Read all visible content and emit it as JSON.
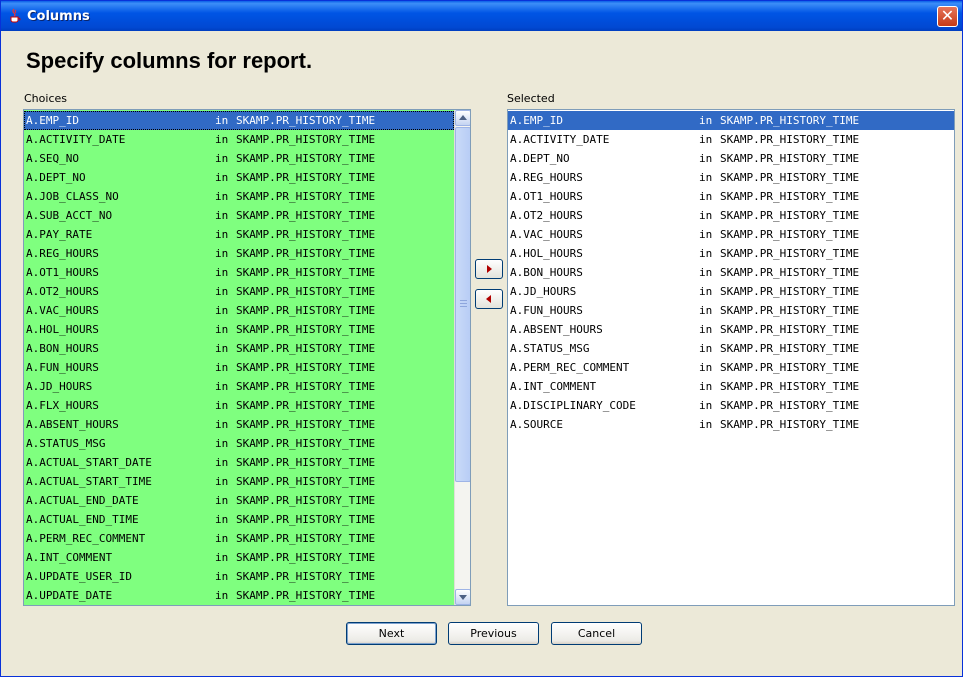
{
  "window": {
    "title": "Columns",
    "close_label": "✕"
  },
  "heading": "Specify columns for report.",
  "choices": {
    "label": "Choices",
    "items": [
      {
        "column": "A.EMP_ID",
        "in": "in",
        "table": "SKAMP.PR_HISTORY_TIME",
        "selected": true
      },
      {
        "column": "A.ACTIVITY_DATE",
        "in": "in",
        "table": "SKAMP.PR_HISTORY_TIME"
      },
      {
        "column": "A.SEQ_NO",
        "in": "in",
        "table": "SKAMP.PR_HISTORY_TIME"
      },
      {
        "column": "A.DEPT_NO",
        "in": "in",
        "table": "SKAMP.PR_HISTORY_TIME"
      },
      {
        "column": "A.JOB_CLASS_NO",
        "in": "in",
        "table": "SKAMP.PR_HISTORY_TIME"
      },
      {
        "column": "A.SUB_ACCT_NO",
        "in": "in",
        "table": "SKAMP.PR_HISTORY_TIME"
      },
      {
        "column": "A.PAY_RATE",
        "in": "in",
        "table": "SKAMP.PR_HISTORY_TIME"
      },
      {
        "column": "A.REG_HOURS",
        "in": "in",
        "table": "SKAMP.PR_HISTORY_TIME"
      },
      {
        "column": "A.OT1_HOURS",
        "in": "in",
        "table": "SKAMP.PR_HISTORY_TIME"
      },
      {
        "column": "A.OT2_HOURS",
        "in": "in",
        "table": "SKAMP.PR_HISTORY_TIME"
      },
      {
        "column": "A.VAC_HOURS",
        "in": "in",
        "table": "SKAMP.PR_HISTORY_TIME"
      },
      {
        "column": "A.HOL_HOURS",
        "in": "in",
        "table": "SKAMP.PR_HISTORY_TIME"
      },
      {
        "column": "A.BON_HOURS",
        "in": "in",
        "table": "SKAMP.PR_HISTORY_TIME"
      },
      {
        "column": "A.FUN_HOURS",
        "in": "in",
        "table": "SKAMP.PR_HISTORY_TIME"
      },
      {
        "column": "A.JD_HOURS",
        "in": "in",
        "table": "SKAMP.PR_HISTORY_TIME"
      },
      {
        "column": "A.FLX_HOURS",
        "in": "in",
        "table": "SKAMP.PR_HISTORY_TIME"
      },
      {
        "column": "A.ABSENT_HOURS",
        "in": "in",
        "table": "SKAMP.PR_HISTORY_TIME"
      },
      {
        "column": "A.STATUS_MSG",
        "in": "in",
        "table": "SKAMP.PR_HISTORY_TIME"
      },
      {
        "column": "A.ACTUAL_START_DATE",
        "in": "in",
        "table": "SKAMP.PR_HISTORY_TIME"
      },
      {
        "column": "A.ACTUAL_START_TIME",
        "in": "in",
        "table": "SKAMP.PR_HISTORY_TIME"
      },
      {
        "column": "A.ACTUAL_END_DATE",
        "in": "in",
        "table": "SKAMP.PR_HISTORY_TIME"
      },
      {
        "column": "A.ACTUAL_END_TIME",
        "in": "in",
        "table": "SKAMP.PR_HISTORY_TIME"
      },
      {
        "column": "A.PERM_REC_COMMENT",
        "in": "in",
        "table": "SKAMP.PR_HISTORY_TIME"
      },
      {
        "column": "A.INT_COMMENT",
        "in": "in",
        "table": "SKAMP.PR_HISTORY_TIME"
      },
      {
        "column": "A.UPDATE_USER_ID",
        "in": "in",
        "table": "SKAMP.PR_HISTORY_TIME"
      },
      {
        "column": "A.UPDATE_DATE",
        "in": "in",
        "table": "SKAMP.PR_HISTORY_TIME"
      }
    ]
  },
  "selected": {
    "label": "Selected",
    "items": [
      {
        "column": "A.EMP_ID",
        "in": "in",
        "table": "SKAMP.PR_HISTORY_TIME",
        "selected": true
      },
      {
        "column": "A.ACTIVITY_DATE",
        "in": "in",
        "table": "SKAMP.PR_HISTORY_TIME"
      },
      {
        "column": "A.DEPT_NO",
        "in": "in",
        "table": "SKAMP.PR_HISTORY_TIME"
      },
      {
        "column": "A.REG_HOURS",
        "in": "in",
        "table": "SKAMP.PR_HISTORY_TIME"
      },
      {
        "column": "A.OT1_HOURS",
        "in": "in",
        "table": "SKAMP.PR_HISTORY_TIME"
      },
      {
        "column": "A.OT2_HOURS",
        "in": "in",
        "table": "SKAMP.PR_HISTORY_TIME"
      },
      {
        "column": "A.VAC_HOURS",
        "in": "in",
        "table": "SKAMP.PR_HISTORY_TIME"
      },
      {
        "column": "A.HOL_HOURS",
        "in": "in",
        "table": "SKAMP.PR_HISTORY_TIME"
      },
      {
        "column": "A.BON_HOURS",
        "in": "in",
        "table": "SKAMP.PR_HISTORY_TIME"
      },
      {
        "column": "A.JD_HOURS",
        "in": "in",
        "table": "SKAMP.PR_HISTORY_TIME"
      },
      {
        "column": "A.FUN_HOURS",
        "in": "in",
        "table": "SKAMP.PR_HISTORY_TIME"
      },
      {
        "column": "A.ABSENT_HOURS",
        "in": "in",
        "table": "SKAMP.PR_HISTORY_TIME"
      },
      {
        "column": "A.STATUS_MSG",
        "in": "in",
        "table": "SKAMP.PR_HISTORY_TIME"
      },
      {
        "column": "A.PERM_REC_COMMENT",
        "in": "in",
        "table": "SKAMP.PR_HISTORY_TIME"
      },
      {
        "column": "A.INT_COMMENT",
        "in": "in",
        "table": "SKAMP.PR_HISTORY_TIME"
      },
      {
        "column": "A.DISCIPLINARY_CODE",
        "in": "in",
        "table": "SKAMP.PR_HISTORY_TIME"
      },
      {
        "column": "A.SOURCE",
        "in": "in",
        "table": "SKAMP.PR_HISTORY_TIME"
      }
    ]
  },
  "move_buttons": {
    "add_icon": "arrow-right-icon",
    "remove_icon": "arrow-left-icon"
  },
  "buttons": {
    "next": "Next",
    "previous": "Previous",
    "cancel": "Cancel"
  },
  "colors": {
    "choices_bg": "#7fff7f",
    "selection": "#316ac5",
    "titlebar": "#0055e5"
  }
}
